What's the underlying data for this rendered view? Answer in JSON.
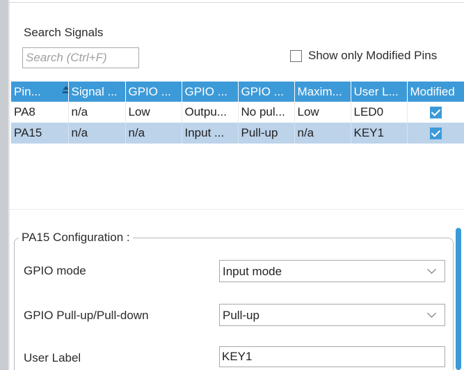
{
  "search": {
    "label": "Search Signals",
    "placeholder": "Search (Ctrl+F)"
  },
  "filter": {
    "show_modified_label": "Show only Modified Pins",
    "checked": false
  },
  "table": {
    "columns": [
      "Pin...",
      "Signal ...",
      "GPIO ...",
      "GPIO ...",
      "GPIO ...",
      "Maxim...",
      "User L...",
      "Modified"
    ],
    "sorted_column": "Pin...",
    "rows": [
      {
        "pin": "PA8",
        "signal": "n/a",
        "gpio_output_level": "Low",
        "gpio_mode": "Outpu...",
        "gpio_pull": "No pul...",
        "max_speed": "Low",
        "user_label": "LED0",
        "modified": true
      },
      {
        "pin": "PA15",
        "signal": "n/a",
        "gpio_output_level": "n/a",
        "gpio_mode": "Input ...",
        "gpio_pull": "Pull-up",
        "max_speed": "n/a",
        "user_label": "KEY1",
        "modified": true
      }
    ],
    "selected_row": 1
  },
  "config": {
    "title": "PA15 Configuration :",
    "gpio_mode_label": "GPIO mode",
    "gpio_mode_value": "Input mode",
    "pull_label": "GPIO Pull-up/Pull-down",
    "pull_value": "Pull-up",
    "user_label_label": "User Label",
    "user_label_value": "KEY1"
  },
  "colors": {
    "header_bg": "#3d9ad8",
    "selected_row_bg": "#bcd3ea",
    "accent": "#3d9ad8"
  }
}
